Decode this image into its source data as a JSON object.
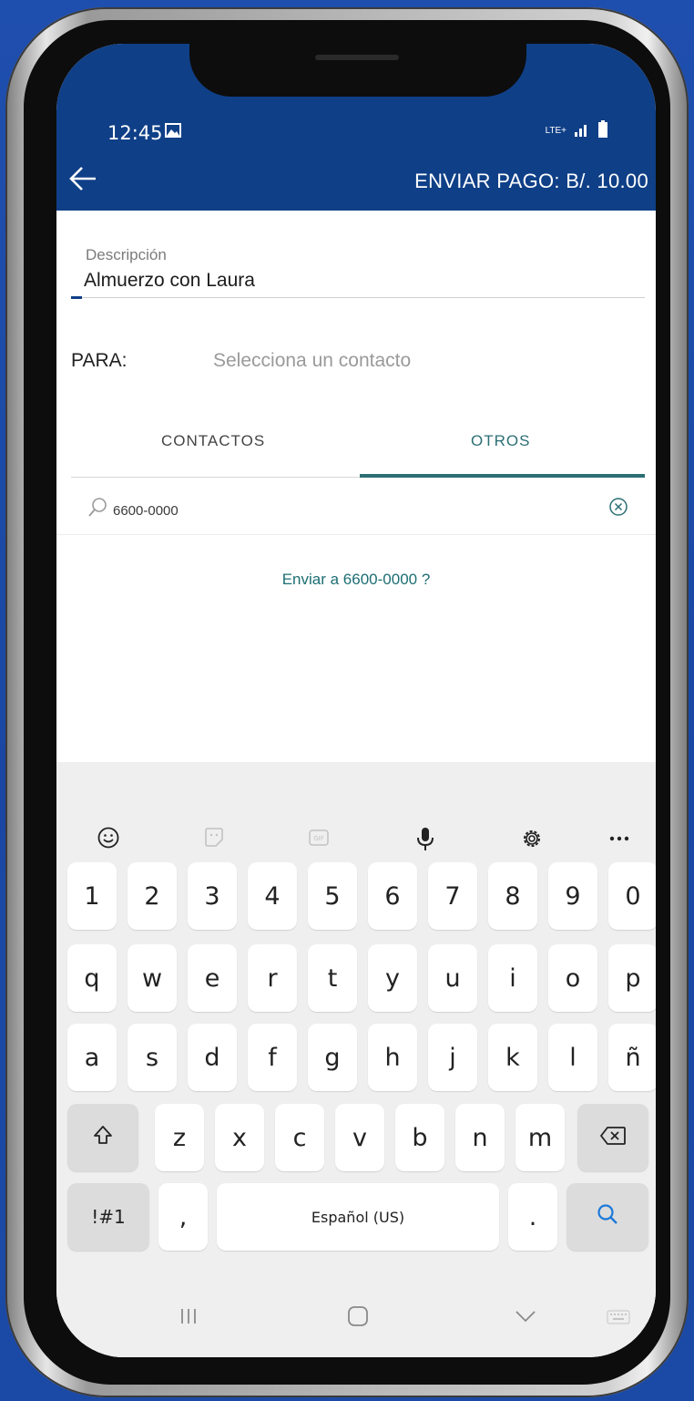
{
  "status_bar": {
    "time": "12:45",
    "network": "LTE+"
  },
  "header": {
    "title": "ENVIAR PAGO: B/. 10.00"
  },
  "description": {
    "label": "Descripción",
    "value": "Almuerzo con Laura"
  },
  "recipient": {
    "label": "PARA:",
    "placeholder": "Selecciona un contacto"
  },
  "tabs": [
    {
      "label": "CONTACTOS",
      "active": false
    },
    {
      "label": "OTROS",
      "active": true
    }
  ],
  "search": {
    "value": "6600-0000"
  },
  "send_prompt": "Enviar a 6600-0000 ?",
  "keyboard": {
    "tools": [
      "emoji-icon",
      "sticker-icon",
      "gif-icon",
      "microphone-icon",
      "settings-gear-icon",
      "more-icon"
    ],
    "rows": [
      [
        "1",
        "2",
        "3",
        "4",
        "5",
        "6",
        "7",
        "8",
        "9",
        "0"
      ],
      [
        "q",
        "w",
        "e",
        "r",
        "t",
        "y",
        "u",
        "i",
        "o",
        "p"
      ],
      [
        "a",
        "s",
        "d",
        "f",
        "g",
        "h",
        "j",
        "k",
        "l",
        "ñ"
      ],
      [
        "z",
        "x",
        "c",
        "v",
        "b",
        "n",
        "m"
      ]
    ],
    "symbols_key": "!#1",
    "comma_key": ",",
    "space_label": "Español (US)",
    "period_key": "."
  },
  "colors": {
    "header_bg": "#0f3f87",
    "accent": "#2b6f75",
    "link": "#1c6e73",
    "background": "#1f4fae"
  }
}
